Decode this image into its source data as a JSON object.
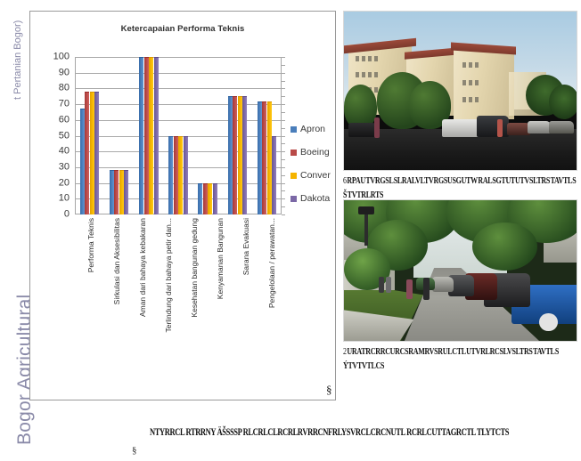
{
  "watermark": {
    "top": "t Pertanian Bogor)",
    "bottom": "Bogor Agricultural"
  },
  "chart_data": {
    "type": "bar",
    "title": "Ketercapaian Performa Teknis",
    "xlabel": "",
    "ylabel": "",
    "ylim": [
      0,
      100
    ],
    "ytick_step": 10,
    "yticks": [
      "100",
      "90",
      "80",
      "70",
      "60",
      "50",
      "40",
      "30",
      "20",
      "10",
      "0"
    ],
    "grid": true,
    "legend_position": "right",
    "categories": [
      "Performa Teknis",
      "Sirkulasi dan Aksesibilitas",
      "Aman dari bahaya kebakaran",
      "Terlindung dari bahaya petir  dan...",
      "Kesehatan bangunan gedung",
      "Kenyamanan Bangunan",
      "Sarana Evakuasi",
      "Pengelolaan / perawatan..."
    ],
    "series": [
      {
        "name": "Apron",
        "color": "#4a7ebb",
        "values": [
          67,
          28,
          100,
          50,
          20,
          75,
          72
        ]
      },
      {
        "name": "Boeing",
        "color": "#b94a48",
        "values": [
          78,
          28,
          100,
          50,
          20,
          75,
          72
        ]
      },
      {
        "name": "Conver",
        "color": "#f5b400",
        "values": [
          78,
          28,
          100,
          50,
          20,
          75,
          72
        ]
      },
      {
        "name": "Dakota",
        "color": "#7b68a6",
        "values": [
          78,
          28,
          100,
          50,
          20,
          75,
          50
        ]
      }
    ]
  },
  "legend": {
    "items": [
      {
        "label": "Apron",
        "color": "#4a7ebb"
      },
      {
        "label": "Boeing",
        "color": "#b94a48"
      },
      {
        "label": "Conver",
        "color": "#f5b400"
      },
      {
        "label": "Dakota",
        "color": "#7b68a6"
      }
    ]
  },
  "chart_panel": {
    "corner_mark": "§"
  },
  "figures": [
    {
      "name": "apartment-blocks-parking",
      "alt": "Apartment buildings with red roofs and cars parked on asphalt lot",
      "caption_number": "6",
      "caption": "RPAU  TVRGSL SLRALVLTVRGSUSGUTW  RALSGTUTUTVSLTRS TAVTL S",
      "caption_line2": "Š TVTRLRTS"
    },
    {
      "name": "tree-lined-street-parking",
      "alt": "Tree lined residential street with cars parked along the kerb",
      "caption_number": "2",
      "caption": "URATRCRRCURCSRAMRVSRULCTL UTVRLRCSLVSLTRS TAVTL S",
      "caption_line2": "ÝTVTVTLCS"
    }
  ],
  "figure_mark": "§",
  "bottom_caption": "NTYRRCL  RTRRNY  ÄŠSSSP RLCRLCLRCRLRVRRCNFRLYSVRCLCRCNUTL RCRLCUTTAGRCTL TLYTCTS",
  "bottom_mark": "§"
}
